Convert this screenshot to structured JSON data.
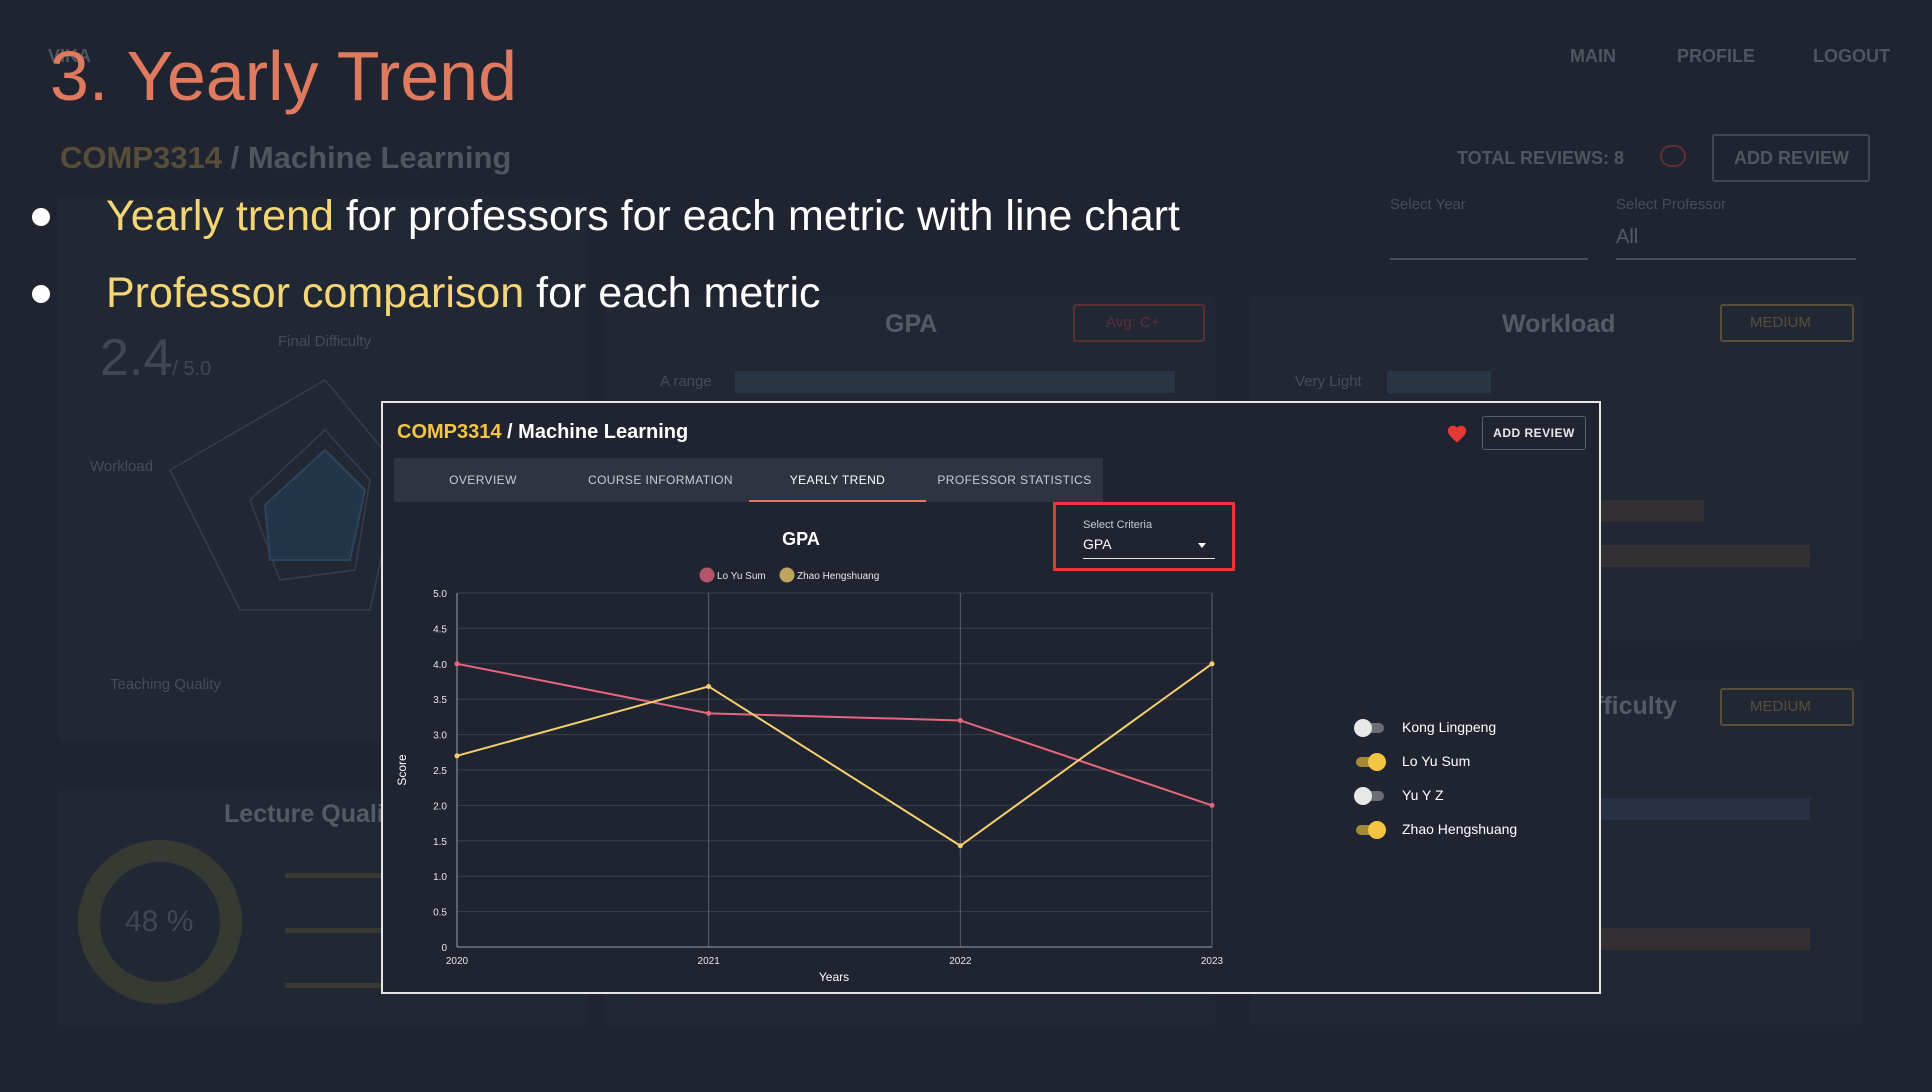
{
  "background": {
    "logo": "VIKA",
    "nav": [
      "MAIN",
      "PROFILE",
      "LOGOUT"
    ],
    "course_code": "COMP3314",
    "course_name": "Machine Learning",
    "total_reviews": "TOTAL REVIEWS: 8",
    "add_review": "ADD REVIEW",
    "select_year": "Select Year",
    "select_professor": "Select Professor",
    "professor_value": "All",
    "gpa_title": "GPA",
    "gpa_badge": "Avg: C+",
    "a_range": "A range",
    "workload_title": "Workload",
    "workload_badge": "MEDIUM",
    "very_light": "Very Light",
    "difficulty_title": "Difficulty",
    "difficulty_badge": "MEDIUM",
    "rating": "2.4",
    "rating_max": "/ 5.0",
    "radar_final": "Final Difficulty",
    "radar_workload": "Workload",
    "radar_teaching": "Teaching Quality",
    "lecture_title": "Lecture Quality",
    "lecture_pct": "48 %"
  },
  "slide": {
    "title": "3. Yearly Trend",
    "bullets": [
      {
        "highlight": "Yearly trend",
        "rest": " for professors for each metric with line chart"
      },
      {
        "highlight": "Professor comparison",
        "rest": " for each metric"
      }
    ]
  },
  "panel": {
    "course_code": "COMP3314",
    "separator": " / ",
    "course_name": "Machine Learning",
    "add_review": "ADD REVIEW",
    "tabs": [
      "OVERVIEW",
      "COURSE INFORMATION",
      "YEARLY TREND",
      "PROFESSOR STATISTICS"
    ],
    "active_tab": "YEARLY TREND",
    "criteria": {
      "label": "Select Criteria",
      "value": "GPA"
    },
    "professors": [
      {
        "name": "Kong Lingpeng",
        "on": false
      },
      {
        "name": "Lo Yu Sum",
        "on": true
      },
      {
        "name": "Yu Y Z",
        "on": false
      },
      {
        "name": "Zhao Hengshuang",
        "on": true
      }
    ]
  },
  "colors": {
    "accent": "#f4c542",
    "title": "#e07a5f",
    "lo": "#e8667f",
    "zhao": "#f4d06f",
    "highlight_box": "#e53935"
  },
  "chart_data": {
    "type": "line",
    "title": "GPA",
    "xlabel": "Years",
    "ylabel": "Score",
    "x": [
      "2020",
      "2021",
      "2022",
      "2023"
    ],
    "ylim": [
      0,
      5
    ],
    "yticks": [
      "0",
      "0.5",
      "1.0",
      "1.5",
      "2.0",
      "2.5",
      "3.0",
      "3.5",
      "4.0",
      "4.5",
      "5.0"
    ],
    "series": [
      {
        "name": "Lo Yu Sum",
        "values": [
          4.0,
          3.3,
          3.2,
          2.0
        ],
        "color": "#e8667f"
      },
      {
        "name": "Zhao Hengshuang",
        "values": [
          2.7,
          3.68,
          1.43,
          4.0
        ],
        "color": "#f4d06f"
      }
    ],
    "grid": true,
    "legend": "top"
  }
}
